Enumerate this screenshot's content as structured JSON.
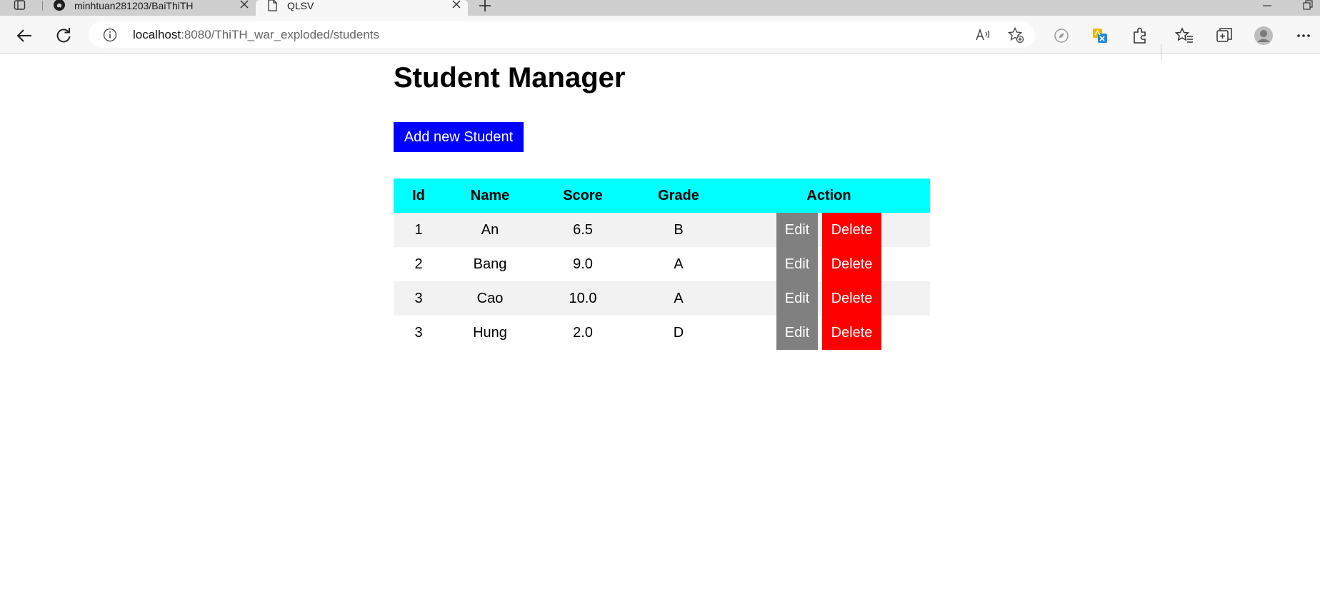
{
  "browser": {
    "tabs": [
      {
        "title": "minhtuan281203/BaiThiTH",
        "icon": "github-icon",
        "active": false
      },
      {
        "title": "QLSV",
        "icon": "page-icon",
        "active": true
      }
    ],
    "url_host": "localhost",
    "url_path": ":8080/ThiTH_war_exploded/students"
  },
  "page": {
    "title": "Student Manager",
    "add_button": "Add new Student",
    "table": {
      "headers": [
        "Id",
        "Name",
        "Score",
        "Grade",
        "Action"
      ],
      "rows": [
        {
          "id": "1",
          "name": "An",
          "score": "6.5",
          "grade": "B"
        },
        {
          "id": "2",
          "name": "Bang",
          "score": "9.0",
          "grade": "A"
        },
        {
          "id": "3",
          "name": "Cao",
          "score": "10.0",
          "grade": "A"
        },
        {
          "id": "3",
          "name": "Hung",
          "score": "2.0",
          "grade": "D"
        }
      ],
      "edit_label": "Edit",
      "delete_label": "Delete"
    }
  },
  "colors": {
    "header_bg": "#00ffff",
    "add_button_bg": "#0000ff",
    "edit_bg": "#808080",
    "delete_bg": "#ff0000",
    "odd_row_bg": "#f2f2f2"
  }
}
